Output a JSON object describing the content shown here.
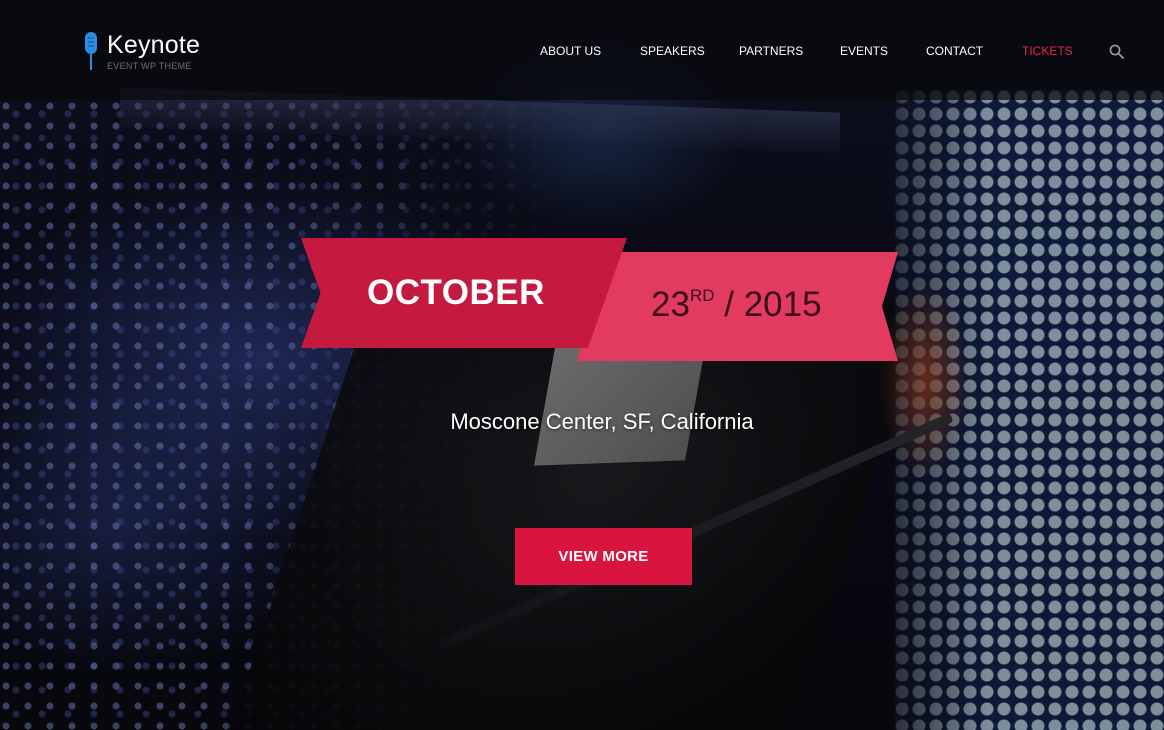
{
  "brand": {
    "title": "Keynote",
    "tagline": "EVENT WP THEME",
    "logo_icon": "microphone-icon",
    "accent_color": "#2a8fe0"
  },
  "nav": {
    "items": [
      {
        "label": "ABOUT US"
      },
      {
        "label": "SPEAKERS"
      },
      {
        "label": "PARTNERS"
      },
      {
        "label": "EVENTS"
      },
      {
        "label": "CONTACT"
      },
      {
        "label": "TICKETS",
        "active": true
      }
    ],
    "search_icon": "search-icon",
    "active_color": "#e8254f"
  },
  "hero": {
    "month": "OCTOBER",
    "day": "23",
    "day_suffix": "RD",
    "separator": "/",
    "year": "2015",
    "venue": "Moscone Center, SF, California",
    "cta_label": "VIEW MORE",
    "ribbon_primary_color": "#c41a3f",
    "ribbon_secondary_color": "#e33a5f",
    "cta_color": "#d8143f"
  }
}
